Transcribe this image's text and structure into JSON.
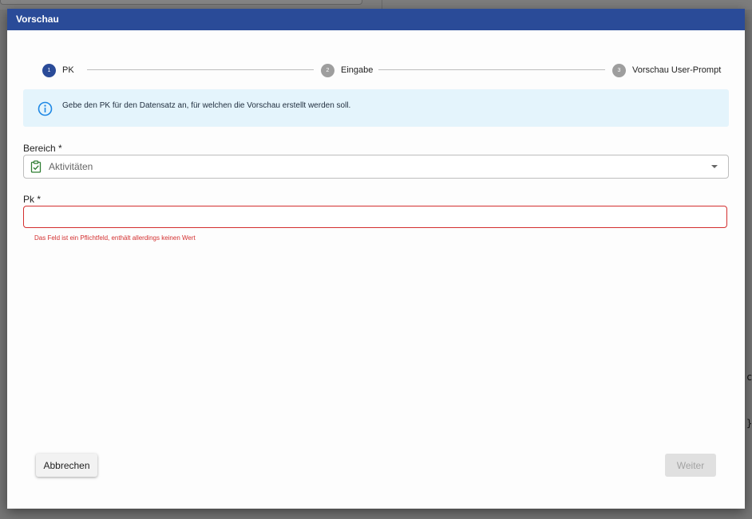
{
  "dialog": {
    "title": "Vorschau"
  },
  "stepper": {
    "steps": [
      {
        "number": "1",
        "label": "PK",
        "state": "active"
      },
      {
        "number": "2",
        "label": "Eingabe",
        "state": "inactive"
      },
      {
        "number": "3",
        "label": "Vorschau User-Prompt",
        "state": "inactive"
      }
    ]
  },
  "info": {
    "icon": "info-circle-icon",
    "text": "Gebe den PK für den Datensatz an, für welchen die Vorschau erstellt werden soll."
  },
  "form": {
    "bereich": {
      "label": "Bereich *",
      "value": "Aktivitäten",
      "icon": "clipboard-check-icon"
    },
    "pk": {
      "label": "Pk *",
      "value": "",
      "error": "Das Feld ist ein Pflichtfeld, enthält allerdings keinen Wert"
    }
  },
  "actions": {
    "cancel_label": "Abbrechen",
    "next_label": "Weiter"
  },
  "background": {
    "glyph_1": "c",
    "glyph_2": "}"
  },
  "colors": {
    "header": "#2a4b98",
    "active_step": "#2a4b98",
    "inactive_step": "#9e9e9e",
    "info_background": "#e4f4fc",
    "info_icon": "#1e88e5",
    "error": "#d32f2f",
    "select_icon": "#2e7d32"
  }
}
